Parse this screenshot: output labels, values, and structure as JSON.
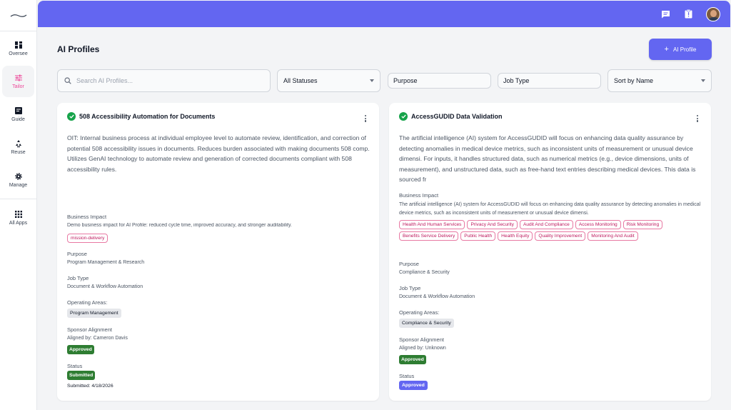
{
  "sidebar": {
    "items": [
      {
        "label": "Oversee",
        "icon": "dashboard-icon"
      },
      {
        "label": "Tailor",
        "icon": "sliders-icon"
      },
      {
        "label": "Guide",
        "icon": "guide-icon"
      },
      {
        "label": "Reuse",
        "icon": "recycle-icon"
      },
      {
        "label": "Manage",
        "icon": "gear-icon"
      },
      {
        "label": "All Apps",
        "icon": "grid-icon"
      }
    ],
    "active": "Tailor"
  },
  "topbar": {
    "icons": [
      "chat-icon",
      "clipboard-alert-icon",
      "user-avatar"
    ]
  },
  "page": {
    "title": "AI Profiles",
    "add_button": "AI Profile"
  },
  "filters": {
    "search_placeholder": "Search AI Profiles...",
    "status": "All Statuses",
    "purpose": "Purpose",
    "job_type": "Job Type",
    "sort": "Sort by Name"
  },
  "cards": [
    {
      "title": "508 Accessibility Automation for Documents",
      "description": "OIT: Internal business process at individual employee level to automate review, identification, and correction of potential 508 accessibility issues in documents. Reduces burden associated with making documents 508 comp. Utilizes GenAI technology to automate review and generation of corrected documents compliant with 508 accessibility rules.",
      "business_impact_label": "Business Impact",
      "business_impact": "Demo business impact for AI Profile: reduced cycle time, improved accuracy, and stronger auditability.",
      "tags": [
        "mission-delivery"
      ],
      "purpose_label": "Purpose",
      "purpose": "Program Management & Research",
      "job_type_label": "Job Type",
      "job_type": "Document & Workflow Automation",
      "operating_areas_label": "Operating Areas:",
      "operating_area": "Program Management",
      "sponsor_label": "Sponsor Alignment",
      "aligned_by": "Aligned by: Cameron Davis",
      "sponsor_status": "Approved",
      "status_label": "Status",
      "status": "Submitted",
      "submitted": "Submitted: 4/18/2026"
    },
    {
      "title": "AccessGUDID Data Validation",
      "description": "The artificial intelligence (AI) system for AccessGUDID will focus on enhancing data quality assurance by detecting anomalies in medical device metrics, such as inconsistent units of measurement or unusual device dimensi. For inputs, it handles structured data, such as numerical metrics (e.g., device dimensions, units of measurement), and unstructured data, such as free-hand text entries describing medical devices. This data is sourced fr",
      "business_impact_label": "Business Impact",
      "business_impact": "The artificial intelligence (AI) system for AccessGUDID will focus on enhancing data quality assurance by detecting anomalies in medical device metrics, such as inconsistent units of measurement or unusual device dimensi.",
      "tags": [
        "Health And Human Services",
        "Privacy And Security",
        "Audit And Compliance",
        "Access Monitoring",
        "Risk Monitoring",
        "Benefits Service Delivery",
        "Public Health",
        "Health Equity",
        "Quality Improvement",
        "Monitoring And Audit"
      ],
      "purpose_label": "Purpose",
      "purpose": "Compliance & Security",
      "job_type_label": "Job Type",
      "job_type": "Document & Workflow Automation",
      "operating_areas_label": "Operating Areas:",
      "operating_area": "Compliance & Security",
      "sponsor_label": "Sponsor Alignment",
      "aligned_by": "Aligned by: Unknown",
      "sponsor_status": "Approved",
      "status_label": "Status",
      "status": "Approved"
    }
  ]
}
